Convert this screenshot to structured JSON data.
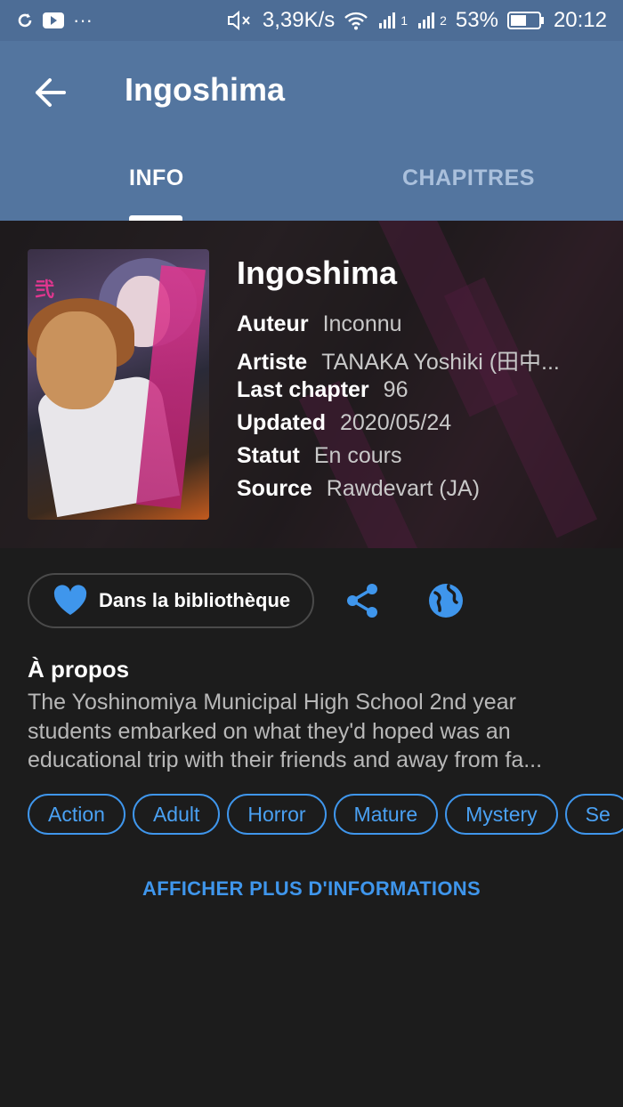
{
  "statusbar": {
    "net_speed": "3,39K/s",
    "sim1": "1",
    "sim2": "2",
    "battery": "53%",
    "time": "20:12",
    "dots": "···"
  },
  "appbar": {
    "title": "Ingoshima",
    "tabs": [
      {
        "label": "INFO",
        "active": true
      },
      {
        "label": "CHAPITRES",
        "active": false
      }
    ]
  },
  "manga": {
    "title": "Ingoshima",
    "cover_volume_mark": "弐",
    "meta": [
      {
        "key": "Auteur",
        "value": "Inconnu"
      },
      {
        "key": "Artiste",
        "value": "TANAKA Yoshiki (田中..."
      },
      {
        "key": "Last chapter",
        "value": "96"
      },
      {
        "key": "Updated",
        "value": "2020/05/24"
      },
      {
        "key": "Statut",
        "value": "En cours"
      },
      {
        "key": "Source",
        "value": "Rawdevart (JA)"
      }
    ]
  },
  "actions": {
    "library_label": "Dans la bibliothèque"
  },
  "about": {
    "heading": "À propos",
    "text": "The Yoshinomiya Municipal High School 2nd year students embarked on what they'd hoped was an educational trip with their friends and away from fa..."
  },
  "genres": [
    "Action",
    "Adult",
    "Horror",
    "Mature",
    "Mystery",
    "Se"
  ],
  "more_label": "AFFICHER PLUS D'INFORMATIONS",
  "colors": {
    "appbar": "#53759f",
    "statusbar": "#4d6d96",
    "background": "#1c1c1c",
    "accent": "#3f96ec"
  }
}
